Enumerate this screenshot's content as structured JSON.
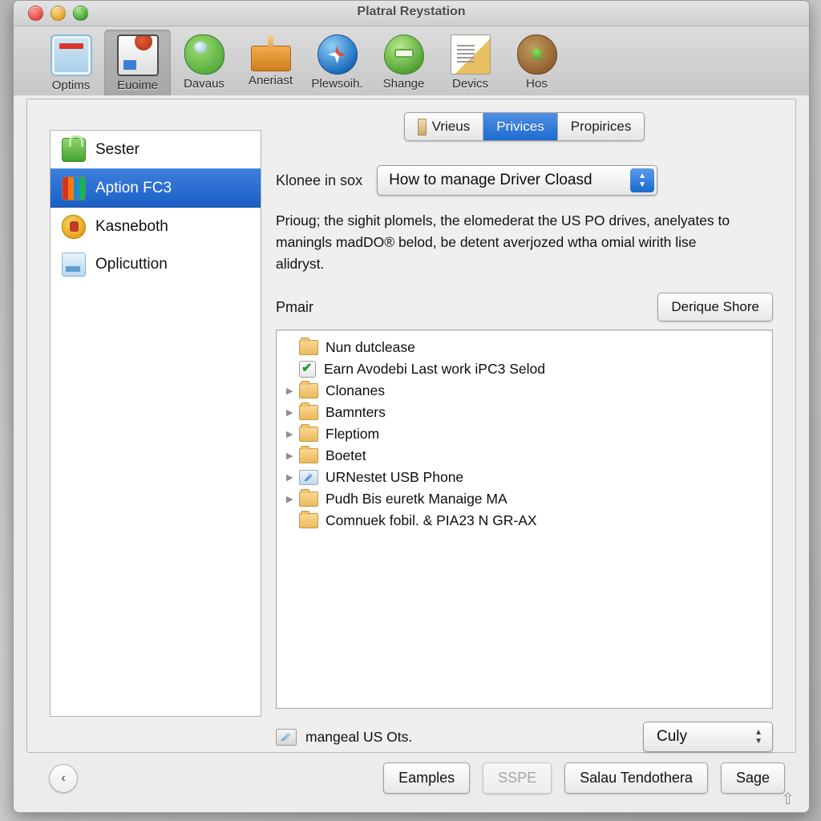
{
  "window": {
    "title": "Platral Reystation",
    "traffic_lights": [
      "close-button",
      "minimize-button",
      "zoom-button"
    ]
  },
  "toolbar": {
    "items": [
      {
        "label": "Optims",
        "icon": "document-window-icon",
        "selected": false
      },
      {
        "label": "Euoime",
        "icon": "photo-editor-icon",
        "selected": true
      },
      {
        "label": "Davaus",
        "icon": "green-device-icon",
        "selected": false
      },
      {
        "label": "Aneriast",
        "icon": "amber-plug-icon",
        "selected": false
      },
      {
        "label": "Plewsoih.",
        "icon": "compass-icon",
        "selected": false
      },
      {
        "label": "Shange",
        "icon": "green-balloon-icon",
        "selected": false
      },
      {
        "label": "Devics",
        "icon": "document-page-icon",
        "selected": false
      },
      {
        "label": "Hos",
        "icon": "wood-shield-icon",
        "selected": false
      }
    ]
  },
  "sidebar": {
    "items": [
      {
        "label": "Sester",
        "icon": "green-lock-icon",
        "selected": false
      },
      {
        "label": "Aption FC3",
        "icon": "photo-tiles-icon",
        "selected": true
      },
      {
        "label": "Kasneboth",
        "icon": "money-bag-icon",
        "selected": false
      },
      {
        "label": "Oplicuttion",
        "icon": "blue-card-icon",
        "selected": false
      }
    ]
  },
  "tabs": [
    {
      "label": "Vrieus",
      "active": false,
      "icon": "bookmark-icon"
    },
    {
      "label": "Privices",
      "active": true,
      "icon": ""
    },
    {
      "label": "Propirices",
      "active": false,
      "icon": ""
    }
  ],
  "content": {
    "field_label": "Klonee in sox",
    "popup_value": "How to manage Driver Cloasd",
    "description": "Prioug; the sighit plomels, the elomederat the US PO drives, anelyates to maningls madDO® belod, be detent averjozed wtha omial wirith lise alidryst.",
    "sub_label": "Pmair",
    "action_button": "Derique Shore",
    "list": [
      {
        "text": "Nun dutclease",
        "icon": "folder-icon",
        "disclosure": false,
        "checked": false
      },
      {
        "text": "Earn Avodebi Last work iPC3 Selod",
        "icon": "checkbox-icon",
        "disclosure": false,
        "checked": true
      },
      {
        "text": "Clonanes",
        "icon": "folder-icon",
        "disclosure": true,
        "checked": false
      },
      {
        "text": "Bamnters",
        "icon": "folder-icon",
        "disclosure": true,
        "checked": false
      },
      {
        "text": "Fleptiom",
        "icon": "folder-icon",
        "disclosure": true,
        "checked": false
      },
      {
        "text": "Boetet",
        "icon": "folder-icon",
        "disclosure": true,
        "checked": false
      },
      {
        "text": "URNestet USB Phone",
        "icon": "network-icon",
        "disclosure": true,
        "checked": false
      },
      {
        "text": "Pudh Bis euretk Manaige MA",
        "icon": "folder-icon",
        "disclosure": true,
        "checked": false
      },
      {
        "text": "Comnuek fobil. & PIA23 N GR-AX",
        "icon": "folder-icon",
        "disclosure": false,
        "checked": false
      }
    ],
    "status_text": "mangeal US Ots.",
    "status_icon": "share-icon",
    "stepper_value": "Culy"
  },
  "footer": {
    "back_button": "‹",
    "buttons": [
      {
        "label": "Eamples",
        "disabled": false
      },
      {
        "label": "SSPE",
        "disabled": true
      },
      {
        "label": "Salau Tendothera",
        "disabled": false
      },
      {
        "label": "Sage",
        "disabled": false
      }
    ],
    "resize_grip": "⇧"
  },
  "colors": {
    "accent_blue": "#1f6bd0",
    "selection_blue": "#2f6fd8",
    "window_bg": "#ececec",
    "folder_amber": "#eab95c",
    "check_green": "#1a9c2f"
  }
}
